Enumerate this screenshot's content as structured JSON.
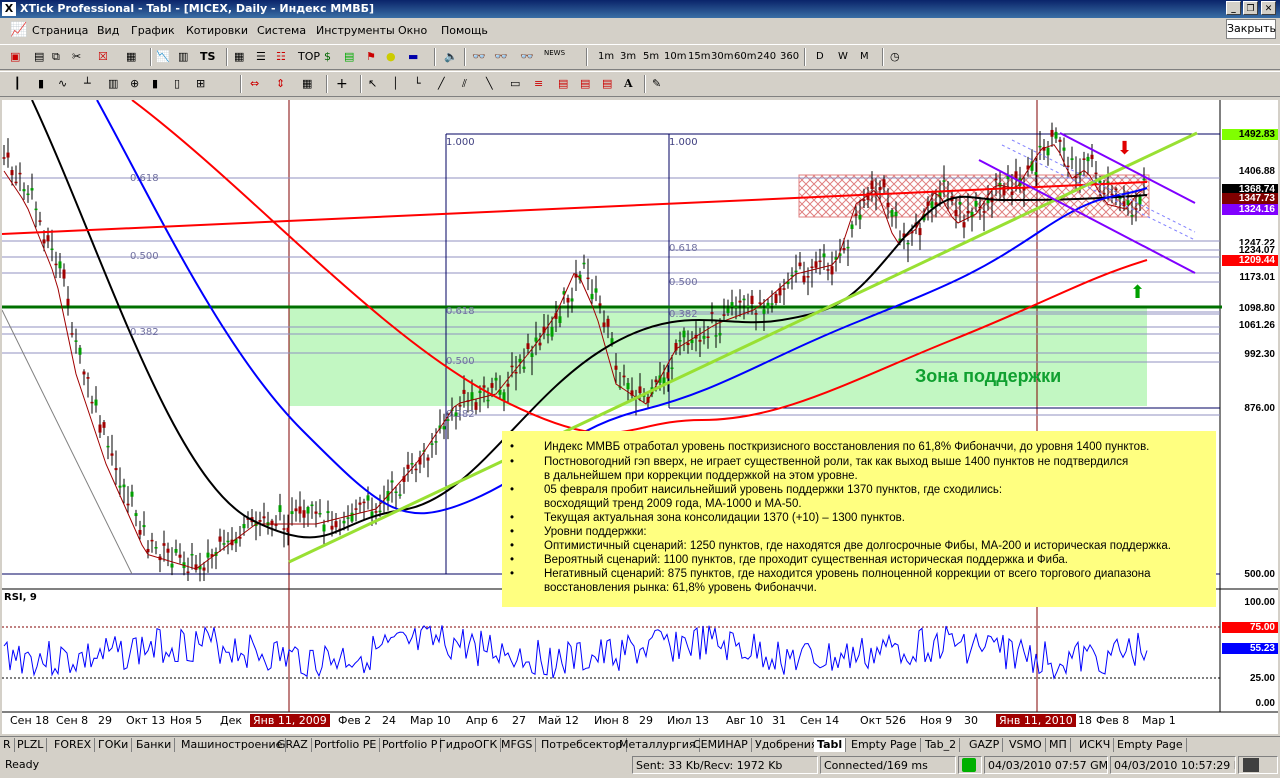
{
  "window": {
    "title": "XTick Professional - Tabl - [MICEX, Daily - Индекс ММВБ]",
    "logo": "X",
    "close_label": "Закрыть",
    "menu": [
      "Страница",
      "Вид",
      "График",
      "Котировки",
      "Система",
      "Инструменты",
      "Окно",
      "Помощь"
    ],
    "timeframes": [
      "1m",
      "3m",
      "5m",
      "10m",
      "15m",
      "30m",
      "60m",
      "240",
      "360",
      "D",
      "W",
      "M"
    ],
    "toolbar_text": {
      "top": "TOP",
      "news": "NEWS",
      "ts": "TS"
    }
  },
  "chart": {
    "fib_labels_left": {
      "f1000": "1.000",
      "f618": "0.618",
      "f500": "0.500",
      "f382": "0.382"
    },
    "fib_labels_mid": {
      "f1000": "1.000",
      "f618": "0.618",
      "f500": "0.500",
      "f382": "0.382"
    },
    "fib_labels_inner": {
      "f618": "0.618",
      "f500": "0.500",
      "f382": "0.382"
    },
    "zone_label": "Зона поддержки",
    "price_labels": [
      {
        "v": "1492.83",
        "bg": "#80ff00",
        "fg": "#000"
      },
      {
        "v": "1406.88",
        "bg": "#ffffff",
        "fg": "#000"
      },
      {
        "v": "1368.74",
        "bg": "#000000",
        "fg": "#fff"
      },
      {
        "v": "1347.73",
        "bg": "#800000",
        "fg": "#fff"
      },
      {
        "v": "1324.16",
        "bg": "#8000ff",
        "fg": "#fff"
      },
      {
        "v": "1247.22",
        "bg": "#ffffff",
        "fg": "#000"
      },
      {
        "v": "1234.07",
        "bg": "#ffffff",
        "fg": "#000"
      },
      {
        "v": "1209.44",
        "bg": "#ff0000",
        "fg": "#fff"
      },
      {
        "v": "1173.01",
        "bg": "#ffffff",
        "fg": "#000"
      },
      {
        "v": "1098.80",
        "bg": "#ffffff",
        "fg": "#000"
      },
      {
        "v": "1061.26",
        "bg": "#ffffff",
        "fg": "#000"
      },
      {
        "v": "992.30",
        "bg": "#ffffff",
        "fg": "#000"
      },
      {
        "v": "876.00",
        "bg": "#ffffff",
        "fg": "#000"
      },
      {
        "v": "500.00",
        "bg": "#ffffff",
        "fg": "#000"
      }
    ],
    "rsi_label": "RSI, 9",
    "rsi_levels": [
      {
        "v": "100.00",
        "bg": "#ffffff",
        "fg": "#000"
      },
      {
        "v": "75.00",
        "bg": "#ff0000",
        "fg": "#fff"
      },
      {
        "v": "55.23",
        "bg": "#0000ff",
        "fg": "#fff"
      },
      {
        "v": "25.00",
        "bg": "#ffffff",
        "fg": "#000"
      },
      {
        "v": "0.00",
        "bg": "#ffffff",
        "fg": "#000"
      }
    ],
    "dates": [
      "Сен 18",
      "Сен 8",
      "29",
      "Окт 13",
      "Ноя 5",
      "Дек",
      "Янв 11, 2009",
      "Фев 2",
      "24",
      "Мар 10",
      "Апр 6",
      "27",
      "Май 12",
      "Июн 8",
      "29",
      "Июл 13",
      "Авг 10",
      "31",
      "Сен 14",
      "Окт 5",
      "26",
      "Ноя 9",
      "30",
      "Янв 11, 2010",
      "18",
      "Фев 8",
      "Мар 1"
    ]
  },
  "notes": [
    "Индекс ММВБ отработал уровень посткризисного восстановления по 61,8% Фибоначчи, до уровня 1400 пунктов.",
    "Постновогодний гэп вверх, не играет существенной роли, так как выход выше 1400 пунктов не подтвердился",
    "в дальнейшем при коррекции поддержкой на этом уровне.",
    "05 февраля пробит наисильнейший уровень поддержки 1370 пунктов, где сходились:",
    "восходящий тренд 2009 года, МА-1000 и МА-50.",
    "Текущая актуальная зона консолидации 1370 (+10) – 1300 пунктов.",
    "Уровни поддержки:",
    "Оптимистичный сценарий: 1250 пунктов, где находятся две долгосрочные Фибы, МА-200 и историческая поддержка.",
    "Вероятный сценарий: 1100 пунктов, где проходит существенная историческая поддержка и Фиба.",
    "Негативный сценарий: 875 пунктов, где находится уровень полноценной коррекции от всего торгового диапазона",
    "восстановления рынка: 61,8% уровень Фибоначчи."
  ],
  "note_bullet": "•",
  "tabs": [
    "R",
    "PLZL",
    "FOREX",
    "ГОКи",
    "Банки",
    "Машиностроение",
    "GRAZ",
    "Portfolio PE",
    "Portfolio P",
    "ГидроОГК",
    "MFGS",
    "Потребсектор",
    "Металлургия",
    "СЕМИНАР",
    "Удобрения",
    "Tabl",
    "Empty Page",
    "Tab_2",
    "GAZP",
    "VSMO",
    "МП",
    "ИСКЧ",
    "Empty Page"
  ],
  "active_tab": "Tabl",
  "status": {
    "ready": "Ready",
    "sent": "Sent: 33 Kb/Recv: 1972 Kb",
    "connected": "Connected/169 ms",
    "gmt": "04/03/2010 07:57 GMT",
    "local": "04/03/2010 10:57:29 Local"
  },
  "colors": {
    "ma_black": "#000000",
    "ma_blue": "#0000ff",
    "ma_red": "#ff0000",
    "trend_green": "#99e033",
    "channel": "#8000ff",
    "zone": "#b3f5b3",
    "note_bg": "#ffff80"
  }
}
